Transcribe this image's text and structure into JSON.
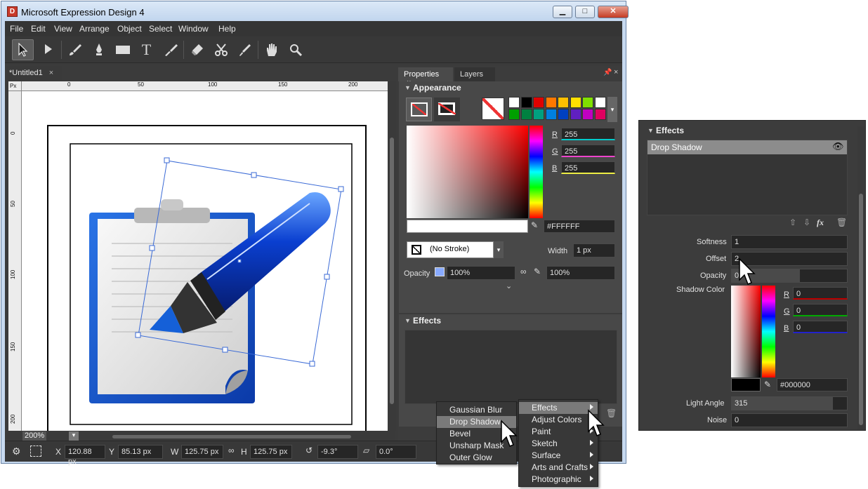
{
  "window": {
    "title": "Microsoft Expression Design 4",
    "controls": {
      "minimize": "▁",
      "maximize": "□",
      "close": "✕"
    },
    "app_icon": "expression-design-icon"
  },
  "menu": [
    "File",
    "Edit",
    "View",
    "Arrange",
    "Object",
    "Select",
    "Window",
    "Help"
  ],
  "toolbar": {
    "tools": [
      "selection-tool-icon",
      "direct-selection-tool-icon",
      "brush-tool-icon",
      "pen-tool-icon",
      "rectangle-tool-icon",
      "text-tool-icon",
      "eyedropper-paint-tool-icon",
      "eraser-tool-icon",
      "scissors-tool-icon",
      "color-picker-tool-icon",
      "pan-hand-tool-icon",
      "zoom-tool-icon"
    ],
    "text_tool_glyph": "T"
  },
  "document": {
    "tab_label": "*Untitled1",
    "tab_close": "×",
    "ruler_unit": "Px",
    "h_ticks": [
      "0",
      "50",
      "100",
      "150",
      "200"
    ],
    "v_ticks": [
      "0",
      "50",
      "100",
      "150",
      "200"
    ]
  },
  "status": {
    "zoom": "200%",
    "x_label": "X",
    "x_value": "120.88 px",
    "y_label": "Y",
    "y_value": "85.13 px",
    "w_label": "W",
    "w_value": "125.75 px",
    "h_label": "H",
    "h_value": "125.75 px",
    "rotation": "-9.3°",
    "skew": "0.0°"
  },
  "panel": {
    "tabs": [
      "Properties",
      "Layers"
    ],
    "tab_close": "×",
    "appearance_title": "Appearance",
    "r_label": "R",
    "r_value": "255",
    "g_label": "G",
    "g_value": "255",
    "b_label": "B",
    "b_value": "255",
    "hex_value": "#FFFFFF",
    "stroke_value": "(No Stroke)",
    "width_label": "Width",
    "width_value": "1 px",
    "opacity_label": "Opacity",
    "opacity_value": "100%",
    "opacity_value2": "100%",
    "effects_title": "Effects",
    "fx_label": "fx"
  },
  "swatches": [
    "#ffffff",
    "#000000",
    "#e00000",
    "#ff7800",
    "#ffc000",
    "#ffe000",
    "#80e000",
    "#ffffff",
    "#00a000",
    "#008040",
    "#00a080",
    "#0080e0",
    "#0040c0",
    "#6020c0",
    "#c000c0",
    "#e00060"
  ],
  "effects_menu": {
    "items": [
      "Effects",
      "Adjust Colors",
      "Paint",
      "Sketch",
      "Surface",
      "Arts and Crafts",
      "Photographic"
    ],
    "highlighted": "Effects"
  },
  "effects_submenu": {
    "items": [
      "Gaussian Blur",
      "Drop Shadow",
      "Bevel",
      "Unsharp Mask",
      "Outer Glow"
    ],
    "highlighted": "Drop Shadow"
  },
  "effects_detail": {
    "title": "Effects",
    "effect_name": "Drop Shadow",
    "fx_label": "fx",
    "softness_label": "Softness",
    "softness_value": "1",
    "offset_label": "Offset",
    "offset_value": "2",
    "opacity_label": "Opacity",
    "opacity_value": "0",
    "shadow_color_label": "Shadow Color",
    "r_label": "R",
    "r_value": "0",
    "g_label": "G",
    "g_value": "0",
    "b_label": "B",
    "b_value": "0",
    "hex_value": "#000000",
    "light_angle_label": "Light Angle",
    "light_angle_value": "315",
    "noise_label": "Noise",
    "noise_value": "0"
  }
}
